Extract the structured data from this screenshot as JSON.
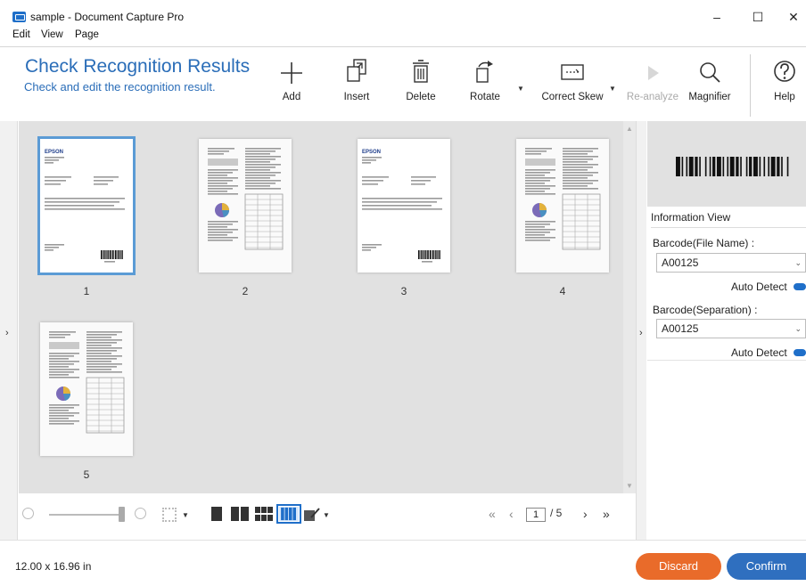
{
  "window": {
    "title": "sample - Document Capture Pro",
    "controls": {
      "minimize": "–",
      "maximize": "☐",
      "close": "✕"
    }
  },
  "menu": {
    "items": [
      "Edit",
      "View",
      "Page"
    ]
  },
  "header": {
    "title": "Check Recognition Results",
    "subtitle": "Check and edit the recognition result."
  },
  "toolbar": {
    "add": "Add",
    "insert": "Insert",
    "delete": "Delete",
    "rotate": "Rotate",
    "correct_skew": "Correct Skew",
    "reanalyze": "Re-analyze",
    "magnifier": "Magnifier",
    "help": "Help"
  },
  "pages": [
    {
      "number": "1",
      "selected": true,
      "type": "letter",
      "logo": "EPSON"
    },
    {
      "number": "2",
      "selected": false,
      "type": "report"
    },
    {
      "number": "3",
      "selected": false,
      "type": "letter",
      "logo": "EPSON"
    },
    {
      "number": "4",
      "selected": false,
      "type": "report"
    },
    {
      "number": "5",
      "selected": false,
      "type": "report"
    }
  ],
  "info_panel": {
    "title": "Information View",
    "barcode_file_label": "Barcode(File Name) :",
    "barcode_file_value": "A00125",
    "barcode_sep_label": "Barcode(Separation) :",
    "barcode_sep_value": "A00125",
    "auto_detect_label": "Auto Detect"
  },
  "pager": {
    "current": "1",
    "separator_total": "/ 5",
    "first": "«",
    "prev": "‹",
    "next": "›",
    "last": "»"
  },
  "status": {
    "size": "12.00 x 16.96 in"
  },
  "actions": {
    "discard": "Discard",
    "confirm": "Confirm"
  },
  "colors": {
    "accent": "#2a6db8",
    "discard": "#e96b2a",
    "confirm": "#2f6fbf",
    "selection": "#5b9bd5"
  }
}
